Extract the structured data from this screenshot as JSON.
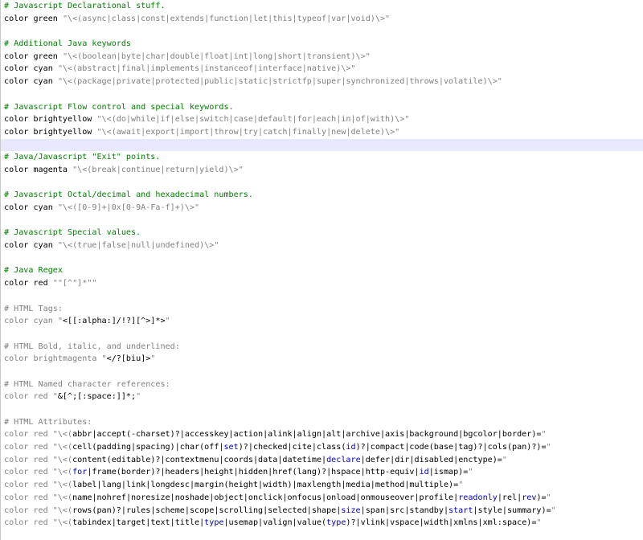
{
  "editor": {
    "current_line": 11,
    "lines": [
      [
        [
          "g",
          "# Javascript Declarational stuff."
        ]
      ],
      [
        [
          "k",
          "color green "
        ],
        [
          "s",
          "\"\\<(async|class|const|extends|function|let|this|typeof|var|void)\\>\""
        ]
      ],
      [],
      [
        [
          "g",
          "# Additional Java keywords"
        ]
      ],
      [
        [
          "k",
          "color green "
        ],
        [
          "s",
          "\"\\<(boolean|byte|char|double|float|int|long|short|transient)\\>\""
        ]
      ],
      [
        [
          "k",
          "color cyan "
        ],
        [
          "s",
          "\"\\<(abstract|final|implements|instanceof|interface|native)\\>\""
        ]
      ],
      [
        [
          "k",
          "color cyan "
        ],
        [
          "s",
          "\"\\<(package|private|protected|public|static|strictfp|super|synchronized|throws|volatile)\\>\""
        ]
      ],
      [],
      [
        [
          "g",
          "# Javascript Flow control and special keywords."
        ]
      ],
      [
        [
          "k",
          "color brightyellow "
        ],
        [
          "s",
          "\"\\<(do|while|if|else|switch|case|default|for|each|in|of|with)\\>\""
        ]
      ],
      [
        [
          "k",
          "color brightyellow "
        ],
        [
          "s",
          "\"\\<(await|export|import|throw|try|catch|finally|new|delete)\\>\""
        ]
      ],
      [],
      [
        [
          "g",
          "# Java/Javascript \"Exit\" points."
        ]
      ],
      [
        [
          "k",
          "color magenta "
        ],
        [
          "s",
          "\"\\<(break|continue|return|yield)\\>\""
        ]
      ],
      [],
      [
        [
          "g",
          "# Javascript Octal/decimal and hexadecimal numbers."
        ]
      ],
      [
        [
          "k",
          "color cyan "
        ],
        [
          "s",
          "\"\\<([0-9]+|0x[0-9A-Fa-f]+)\\>\""
        ]
      ],
      [],
      [
        [
          "g",
          "# Javascript Special values."
        ]
      ],
      [
        [
          "k",
          "color cyan "
        ],
        [
          "s",
          "\"\\<(true|false|null|undefined)\\>\""
        ]
      ],
      [],
      [
        [
          "g",
          "# Java Regex"
        ]
      ],
      [
        [
          "k",
          "color red "
        ],
        [
          "s",
          "\"\"[^\"]*\"\""
        ]
      ],
      [],
      [
        [
          "gr",
          "# HTML Tags:"
        ]
      ],
      [
        [
          "gr",
          "color cyan "
        ],
        [
          "s",
          "\""
        ],
        [
          "t",
          "<[[:alpha:]/!?][^>]*>"
        ],
        [
          "s",
          "\""
        ]
      ],
      [],
      [
        [
          "gr",
          "# HTML Bold, italic, and underlined:"
        ]
      ],
      [
        [
          "gr",
          "color brightmagenta "
        ],
        [
          "s",
          "\""
        ],
        [
          "t",
          "</?[biu]>"
        ],
        [
          "s",
          "\""
        ]
      ],
      [],
      [
        [
          "gr",
          "# HTML Named character references:"
        ]
      ],
      [
        [
          "gr",
          "color red "
        ],
        [
          "s",
          "\""
        ],
        [
          "t",
          "&[^;[:space:]]*;"
        ],
        [
          "s",
          "\""
        ]
      ],
      [],
      [
        [
          "gr",
          "# HTML Attributes:"
        ]
      ],
      [
        [
          "gr",
          "color red "
        ],
        [
          "s",
          "\"\\<("
        ],
        [
          "t",
          "abbr|accept(-charset)?|accesskey|action|alink|align|alt|archive|axis|background|bgcolor|border)="
        ],
        [
          "s",
          "\""
        ]
      ],
      [
        [
          "gr",
          "color red "
        ],
        [
          "s",
          "\"\\<("
        ],
        [
          "t",
          "cell(padding|spacing)|char(off|"
        ],
        [
          "b",
          "set"
        ],
        [
          "t",
          ")?|checked|cite|class("
        ],
        [
          "b",
          "id"
        ],
        [
          "t",
          ")?|compact|code(base|tag)?|cols(pan)?)="
        ],
        [
          "s",
          "\""
        ]
      ],
      [
        [
          "gr",
          "color red "
        ],
        [
          "s",
          "\"\\<("
        ],
        [
          "t",
          "content(editable)?|contextmenu|coords|data|datetime|"
        ],
        [
          "b",
          "declare"
        ],
        [
          "t",
          "|defer|dir|disabled|enctype)="
        ],
        [
          "s",
          "\""
        ]
      ],
      [
        [
          "gr",
          "color red "
        ],
        [
          "s",
          "\"\\<("
        ],
        [
          "b",
          "for"
        ],
        [
          "t",
          "|frame(border)?|headers|height|hidden|href(lang)?|hspace|http-equiv|"
        ],
        [
          "b",
          "id"
        ],
        [
          "t",
          "|ismap)="
        ],
        [
          "s",
          "\""
        ]
      ],
      [
        [
          "gr",
          "color red "
        ],
        [
          "s",
          "\"\\<("
        ],
        [
          "t",
          "label|lang|link|longdesc|margin(height|width)|maxlength|media|method|multiple)="
        ],
        [
          "s",
          "\""
        ]
      ],
      [
        [
          "gr",
          "color red "
        ],
        [
          "s",
          "\"\\<("
        ],
        [
          "t",
          "name|nohref|noresize|noshade|object|onclick|onfocus|onload|onmouseover|profile|"
        ],
        [
          "b",
          "readonly"
        ],
        [
          "t",
          "|rel|"
        ],
        [
          "b",
          "rev"
        ],
        [
          "t",
          ")="
        ],
        [
          "s",
          "\""
        ]
      ],
      [
        [
          "gr",
          "color red "
        ],
        [
          "s",
          "\"\\<("
        ],
        [
          "t",
          "rows(pan)?|rules|scheme|scope|scrolling|selected|shape|"
        ],
        [
          "b",
          "size"
        ],
        [
          "t",
          "|span|src|standby|"
        ],
        [
          "b",
          "start"
        ],
        [
          "t",
          "|style|summary)="
        ],
        [
          "s",
          "\""
        ]
      ],
      [
        [
          "gr",
          "color red "
        ],
        [
          "s",
          "\"\\<("
        ],
        [
          "t",
          "tabindex|target|text|title|"
        ],
        [
          "b",
          "type"
        ],
        [
          "t",
          "|usemap|valign|value("
        ],
        [
          "b",
          "type"
        ],
        [
          "t",
          ")?|vlink|vspace|width|xmlns|xml:space)="
        ],
        [
          "s",
          "\""
        ]
      ]
    ]
  }
}
